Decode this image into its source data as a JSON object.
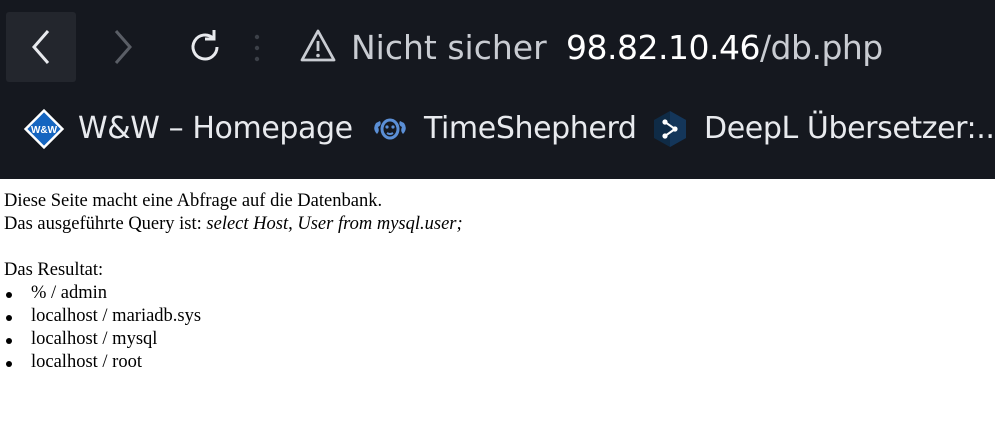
{
  "browser": {
    "security_label": "Nicht sicher",
    "url_host": "98.82.10.46",
    "url_path": "/db.php",
    "bookmarks": [
      {
        "label": "W&W – Homepage",
        "icon": "ww-logo-icon",
        "icon_text": "W&W"
      },
      {
        "label": "TimeShepherd",
        "icon": "timeshepherd-icon"
      },
      {
        "label": "DeepL Übersetzer:...",
        "icon": "deepl-icon"
      }
    ],
    "colors": {
      "chrome_bg": "#15181f",
      "ww_blue": "#1565c0",
      "timeshepherd_blue": "#5b8fd6",
      "deepl_navy": "#0f2b46"
    }
  },
  "page": {
    "intro_line1": "Diese Seite macht eine Abfrage auf die Datenbank.",
    "intro_line2_prefix": "Das ausgeführte Query ist:",
    "query": "select Host, User from mysql.user;",
    "result_heading": "Das Resultat:",
    "results": [
      "% / admin",
      "localhost / mariadb.sys",
      "localhost / mysql",
      "localhost / root"
    ]
  }
}
